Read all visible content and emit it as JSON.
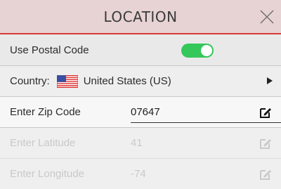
{
  "header": {
    "title": "LOCATION"
  },
  "postal": {
    "label": "Use Postal Code",
    "enabled": true
  },
  "country": {
    "label": "Country:",
    "value": "United States (US)"
  },
  "zip": {
    "label": "Enter Zip Code",
    "value": "07647"
  },
  "latitude": {
    "label": "Enter Latitude",
    "value": "41"
  },
  "longitude": {
    "label": "Enter Longitude",
    "value": "-74"
  },
  "colors": {
    "accent": "#d83a3a",
    "toggle_on": "#34c759",
    "header_bg": "#e7d3d3"
  },
  "icons": {
    "close": "close-icon",
    "edit": "edit-pencil-icon",
    "flag": "us-flag-icon",
    "arrow": "arrow-right-icon"
  }
}
